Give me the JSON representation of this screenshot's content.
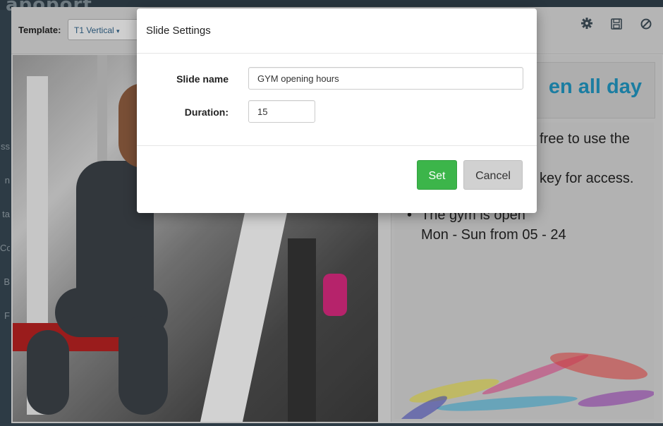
{
  "app": {
    "brand": "apoport"
  },
  "toolbar": {
    "template_label": "Template:",
    "template_value": "T1 Vertical",
    "icons": [
      "gear-icon",
      "save-icon",
      "ban-icon"
    ]
  },
  "slide": {
    "heading": "en all day",
    "lines": [
      "free to use the",
      "key for access.",
      "The gym is open",
      "Mon - Sun from 05 - 24"
    ],
    "bullet": "•"
  },
  "side_nav": [
    "ss",
    "n",
    "ta",
    "Co",
    "B",
    "F"
  ],
  "modal": {
    "title": "Slide Settings",
    "slide_name_label": "Slide name",
    "slide_name_value": "GYM opening hours",
    "duration_label": "Duration:",
    "duration_value": "15",
    "set_label": "Set",
    "cancel_label": "Cancel"
  },
  "colors": {
    "accent_heading": "#1f8fb8",
    "set_button": "#3cb54a",
    "cancel_button": "#d1d1d1"
  }
}
